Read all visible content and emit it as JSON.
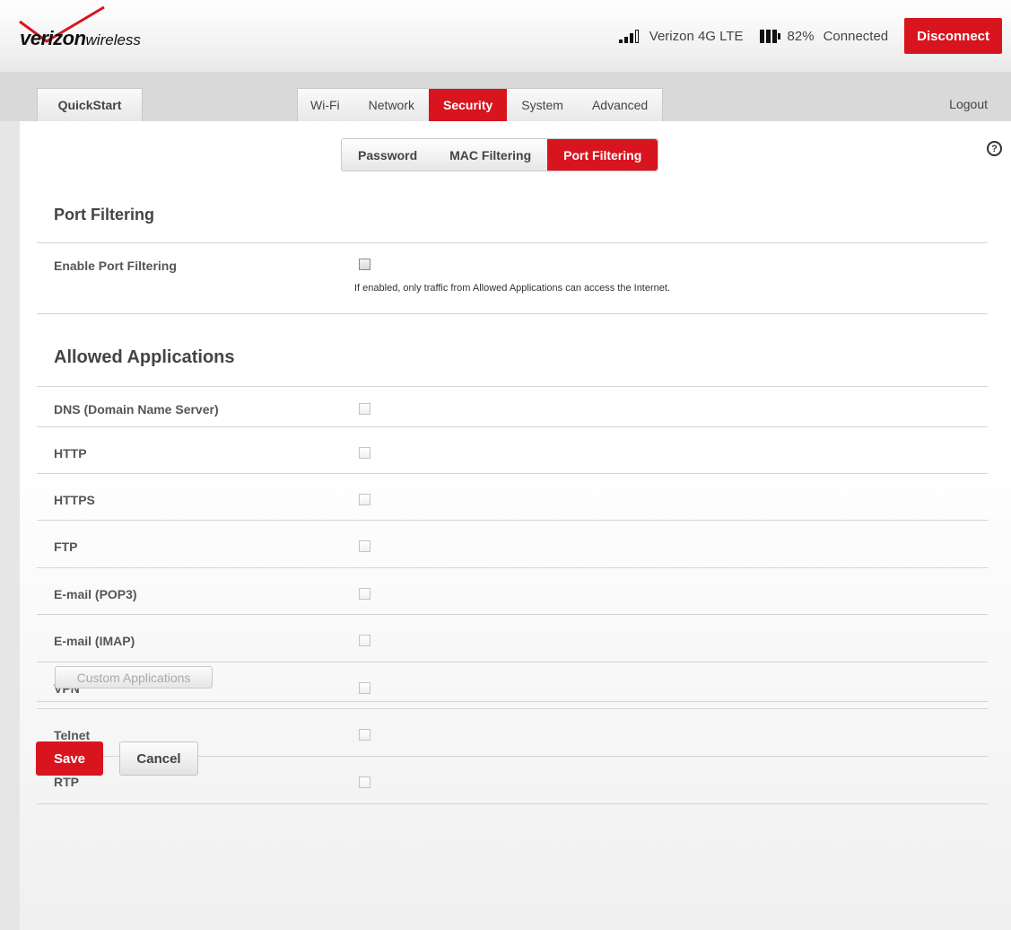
{
  "header": {
    "logo_text_bold": "verizon",
    "logo_text_light": "wireless",
    "network": "Verizon 4G LTE",
    "battery": "82%",
    "status": "Connected",
    "disconnect_label": "Disconnect",
    "signal_icon": "signal-bars-icon",
    "battery_icon": "battery-icon",
    "accent_color": "#d8141e"
  },
  "nav": {
    "quickstart": "QuickStart",
    "tabs": [
      "Wi-Fi",
      "Network",
      "Security",
      "System",
      "Advanced"
    ],
    "active_tab": "Security",
    "logout": "Logout"
  },
  "sub_nav": {
    "tabs": [
      "Password",
      "MAC Filtering",
      "Port Filtering"
    ],
    "active_tab": "Port Filtering",
    "help_icon": "?"
  },
  "port_filtering": {
    "title": "Port Filtering",
    "enable_label": "Enable Port Filtering",
    "enable_checked": false,
    "hint": "If enabled, only traffic from Allowed Applications can access the Internet."
  },
  "allowed_apps": {
    "title": "Allowed Applications",
    "items": [
      {
        "label": "DNS (Domain Name Server)",
        "checked": false
      },
      {
        "label": "HTTP",
        "checked": false
      },
      {
        "label": "HTTPS",
        "checked": false
      },
      {
        "label": "FTP",
        "checked": false
      },
      {
        "label": "E-mail (POP3)",
        "checked": false
      },
      {
        "label": "E-mail (IMAP)",
        "checked": false
      },
      {
        "label": "VPN",
        "checked": false
      },
      {
        "label": "Telnet",
        "checked": false
      },
      {
        "label": "RTP",
        "checked": false
      }
    ],
    "custom_label": "Custom Applications"
  },
  "actions": {
    "save": "Save",
    "cancel": "Cancel"
  }
}
